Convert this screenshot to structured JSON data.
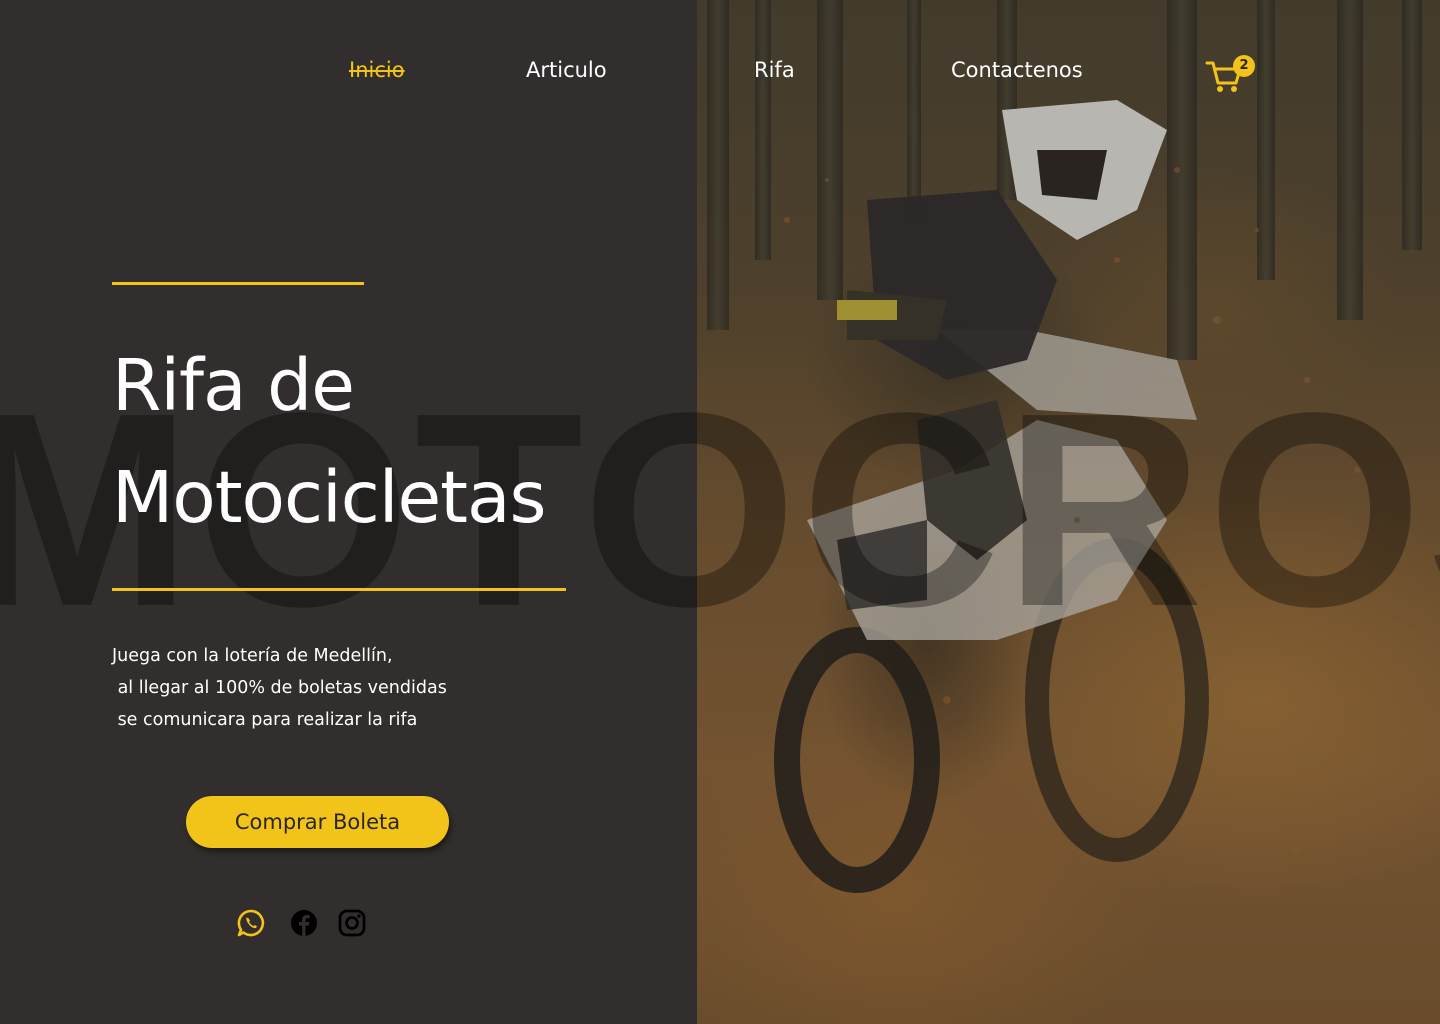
{
  "nav": {
    "items": [
      {
        "label": "Inicio",
        "active": true
      },
      {
        "label": "Articulo",
        "active": false
      },
      {
        "label": "Rifa",
        "active": false
      },
      {
        "label": "Contactenos",
        "active": false
      }
    ],
    "cart": {
      "icon": "cart-icon",
      "count": "2"
    }
  },
  "hero": {
    "background_word": "MOTOCROSS",
    "title_line1": "Rifa de",
    "title_line2": "Motocicletas",
    "description": "Juega con la lotería de Medellín,\n al llegar al 100% de boletas vendidas\n se comunicara para realizar la rifa",
    "cta_label": "Comprar Boleta"
  },
  "social": [
    {
      "icon": "whatsapp-icon",
      "color": "#f2c318"
    },
    {
      "icon": "facebook-icon",
      "color": "#000000"
    },
    {
      "icon": "instagram-icon",
      "color": "#000000"
    }
  ],
  "colors": {
    "accent": "#f2c318",
    "background": "#322e2e",
    "text": "#ffffff"
  }
}
